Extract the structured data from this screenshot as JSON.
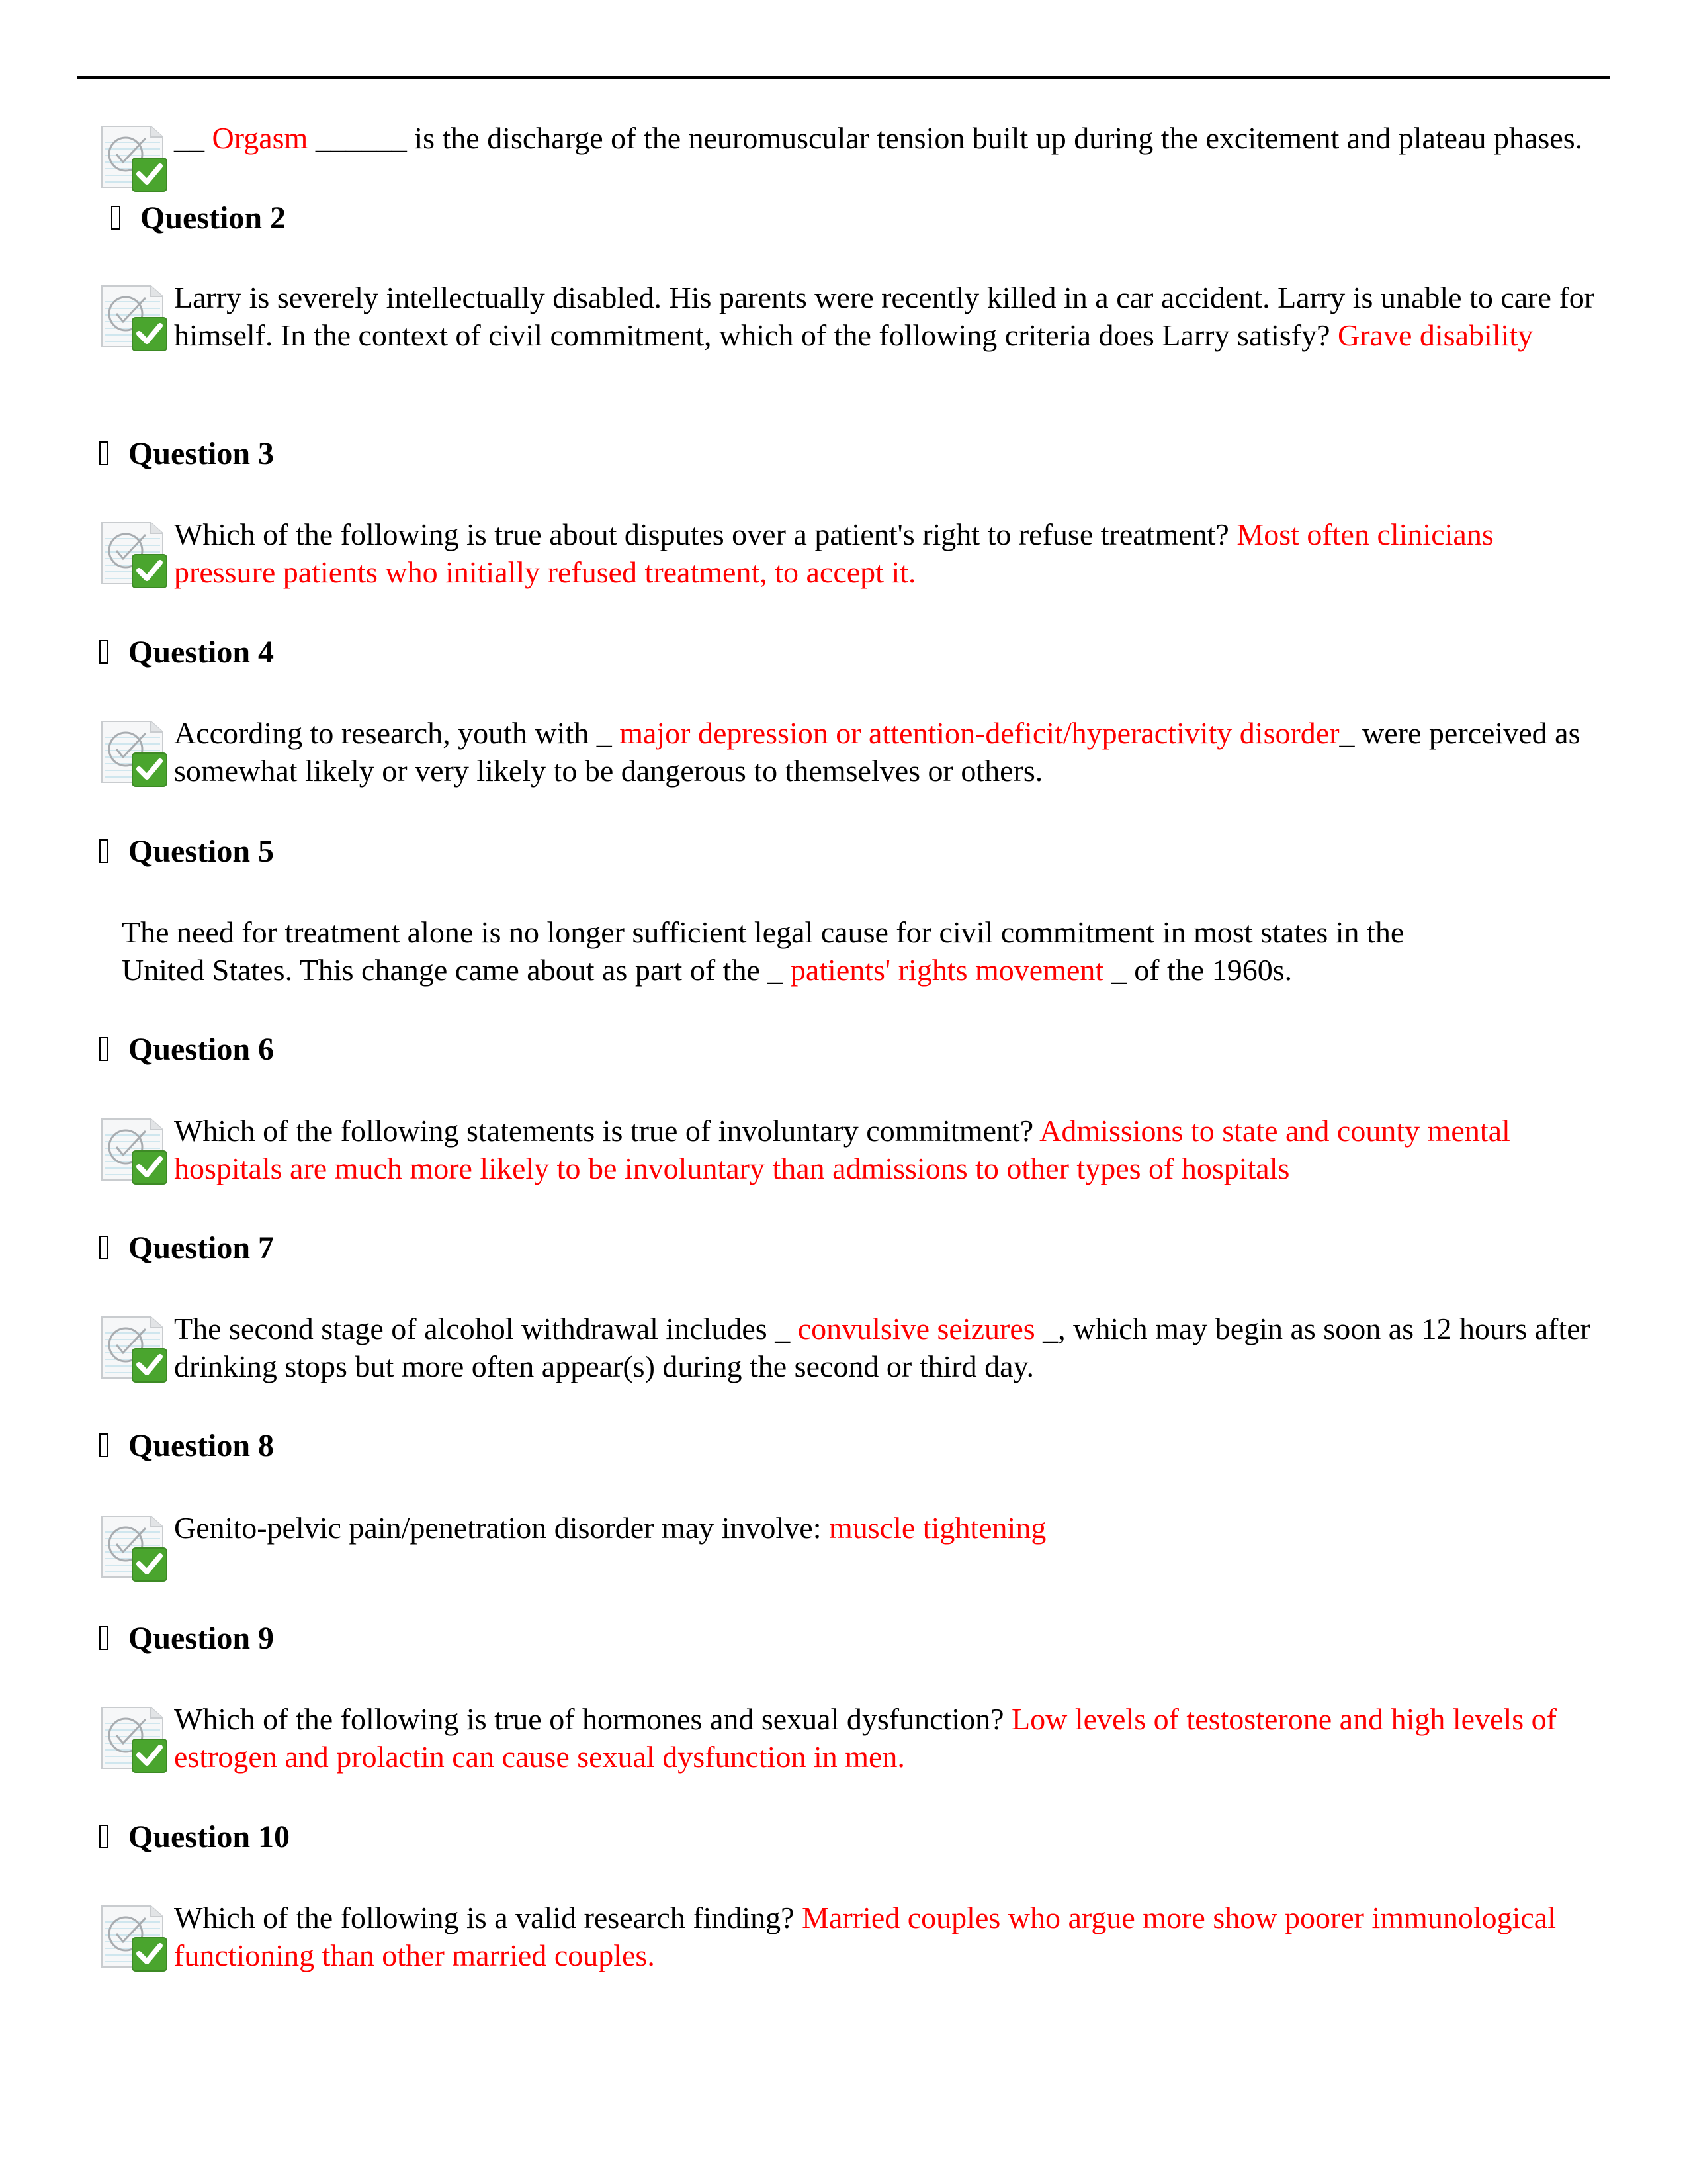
{
  "document": {
    "questions": [
      {
        "heading": "",
        "has_icon": true,
        "parts": [
          {
            "text": "__ ",
            "answer": false
          },
          {
            "text": "Orgasm",
            "answer": true
          },
          {
            "text": " ______ is the discharge of the neuromuscular tension built up during the excitement and plateau phases.",
            "answer": false
          }
        ]
      },
      {
        "heading": "Question 2",
        "has_icon": true,
        "parts": [
          {
            "text": "Larry is severely intellectually disabled. His parents were recently killed in a car accident. Larry is unable to care for himself. In the context of civil commitment, which of the following criteria does Larry satisfy?  ",
            "answer": false
          },
          {
            "text": "Grave disability",
            "answer": true
          }
        ]
      },
      {
        "heading": "Question 3",
        "has_icon": true,
        "parts": [
          {
            "text": "Which of the following is true about disputes over a patient's right to refuse treatment?  ",
            "answer": false
          },
          {
            "text": "Most often clinicians pressure patients who initially refused treatment, to accept it.",
            "answer": true
          }
        ]
      },
      {
        "heading": "Question 4",
        "has_icon": true,
        "parts": [
          {
            "text": "According to research, youth with _ ",
            "answer": false
          },
          {
            "text": "major depression or attention-deficit/hyperactivity disorder",
            "answer": true
          },
          {
            "text": "_ were perceived as somewhat likely or very likely to be dangerous to themselves or others.",
            "answer": false
          }
        ]
      },
      {
        "heading": "Question 5",
        "has_icon": false,
        "parts": [
          {
            "text": "The need for treatment alone is no longer sufficient legal cause for civil commitment in most states in the United States. This change came about as part of the _ ",
            "answer": false
          },
          {
            "text": "patients' rights movement",
            "answer": true
          },
          {
            "text": " _ of the 1960s.",
            "answer": false
          }
        ]
      },
      {
        "heading": "Question 6",
        "has_icon": true,
        "parts": [
          {
            "text": "Which of the following statements is true of involuntary commitment?  ",
            "answer": false
          },
          {
            "text": "Admissions to state and county mental hospitals are much more likely to be involuntary than admissions to other types of hospitals",
            "answer": true
          }
        ]
      },
      {
        "heading": "Question 7",
        "has_icon": true,
        "parts": [
          {
            "text": "The second stage of alcohol withdrawal includes _ ",
            "answer": false
          },
          {
            "text": "convulsive seizures",
            "answer": true
          },
          {
            "text": " _, which may begin as soon as 12 hours after drinking stops but more often appear(s) during the second or third day.",
            "answer": false
          }
        ]
      },
      {
        "heading": "Question 8",
        "has_icon": true,
        "parts": [
          {
            "text": "Genito-pelvic pain/penetration disorder may involve: ",
            "answer": false
          },
          {
            "text": "muscle tightening",
            "answer": true
          }
        ]
      },
      {
        "heading": "Question 9",
        "has_icon": true,
        "parts": [
          {
            "text": "Which of the following is true of hormones and sexual dysfunction?  ",
            "answer": false
          },
          {
            "text": "Low levels of testosterone and high levels of estrogen and prolactin can cause sexual dysfunction in men.",
            "answer": true
          }
        ]
      },
      {
        "heading": "Question 10",
        "has_icon": true,
        "parts": [
          {
            "text": "Which of the following is a valid research finding?  ",
            "answer": false
          },
          {
            "text": "Married couples who argue more show poorer immunological functioning than other married couples.",
            "answer": true
          }
        ]
      }
    ],
    "colors": {
      "answer": "#ff0000",
      "text": "#000000",
      "check_green": "#4aa52e"
    },
    "icons": {
      "question_icon": "correct-answer-check-icon",
      "heading_marker": "missing-glyph-box"
    }
  }
}
